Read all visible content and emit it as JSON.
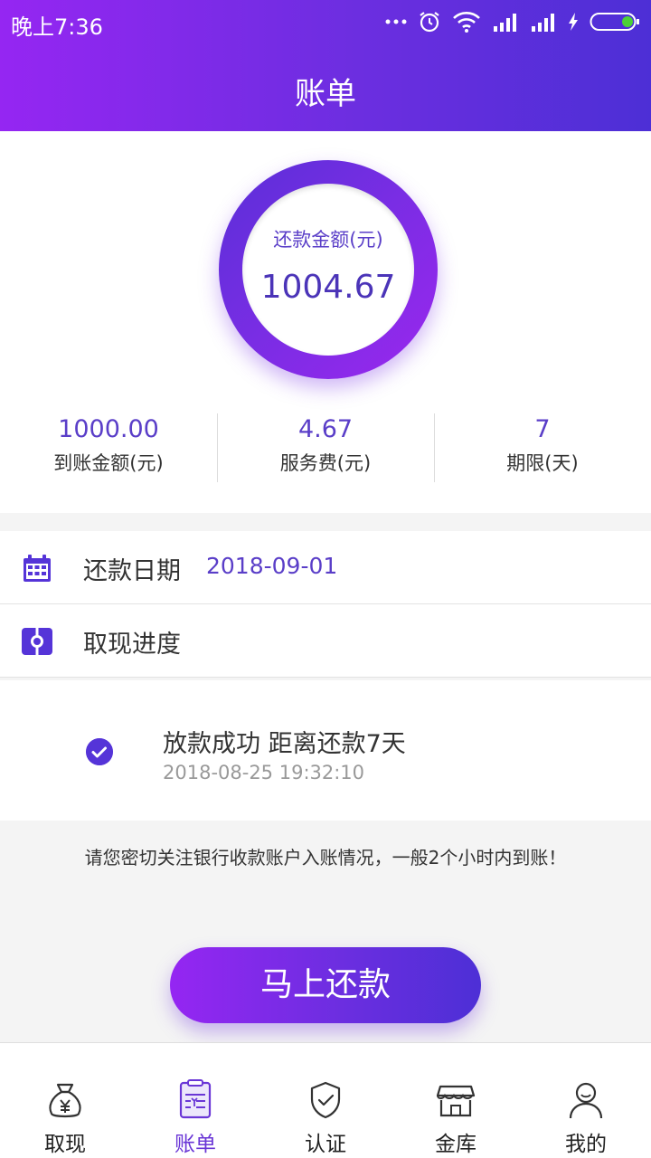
{
  "status_bar": {
    "time": "晚上7:36"
  },
  "header": {
    "title": "账单"
  },
  "summary": {
    "ring_label": "还款金额(元)",
    "ring_amount": "1004.67",
    "stats": [
      {
        "value": "1000.00",
        "label": "到账金额(元)"
      },
      {
        "value": "4.67",
        "label": "服务费(元)"
      },
      {
        "value": "7",
        "label": "期限(天)"
      }
    ]
  },
  "repay_date": {
    "title": "还款日期",
    "value": "2018-09-01"
  },
  "withdraw_progress": {
    "title": "取现进度"
  },
  "progress_item": {
    "title": "放款成功 距离还款7天",
    "time": "2018-08-25 19:32:10"
  },
  "notice": "请您密切关注银行收款账户入账情况，一般2个小时内到账！",
  "pay_button": "马上还款",
  "tabbar": {
    "items": [
      {
        "label": "取现",
        "icon": "money-bag-icon",
        "active": false
      },
      {
        "label": "账单",
        "icon": "bill-icon",
        "active": true
      },
      {
        "label": "认证",
        "icon": "shield-check-icon",
        "active": false
      },
      {
        "label": "金库",
        "icon": "store-icon",
        "active": false
      },
      {
        "label": "我的",
        "icon": "user-icon",
        "active": false
      }
    ]
  },
  "colors": {
    "accent": "#6a36d6",
    "gradient_start": "#9526f2",
    "gradient_end": "#4d2fd6"
  }
}
